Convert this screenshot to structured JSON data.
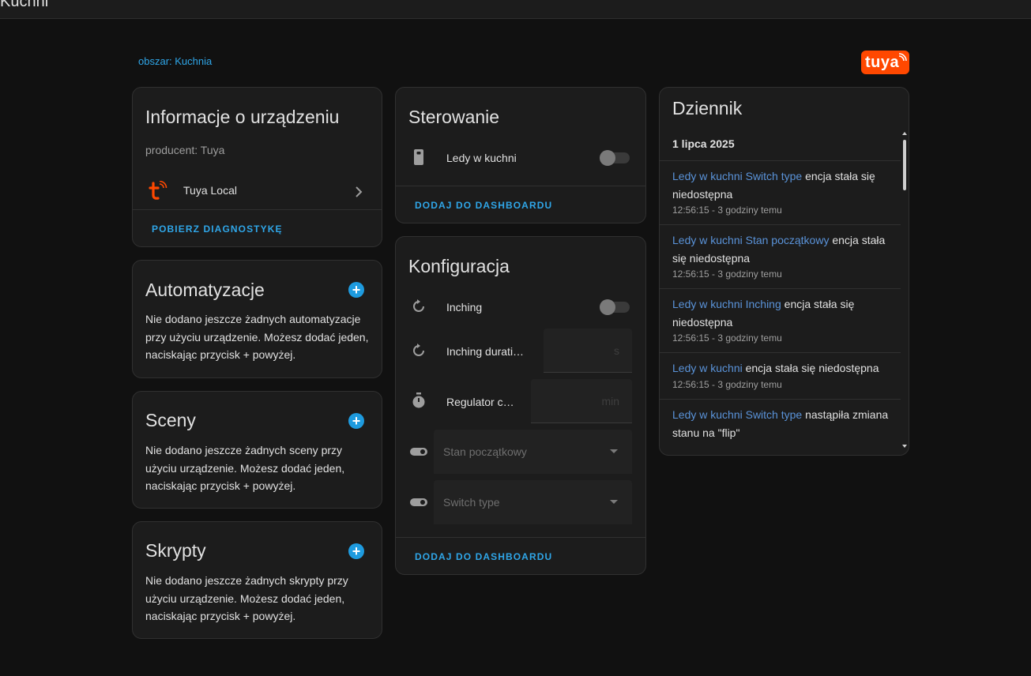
{
  "header": {
    "title": "Kuchni"
  },
  "area_link": "obszar: Kuchnia",
  "brand": {
    "logo_text": "tuya",
    "color": "#ff4800"
  },
  "device_info": {
    "title": "Informacje o urządzeniu",
    "manufacturer": "producent: Tuya",
    "integration": "Tuya Local",
    "action": "POBIERZ DIAGNOSTYKĘ"
  },
  "automations": {
    "title": "Automatyzacje",
    "text": "Nie dodano jeszcze żadnych automatyzacje przy użyciu urządzenie. Możesz dodać jeden, naciskając przycisk + powyżej."
  },
  "scenes": {
    "title": "Sceny",
    "text": "Nie dodano jeszcze żadnych sceny przy użyciu urządzenie. Możesz dodać jeden, naciskając przycisk + powyżej."
  },
  "scripts": {
    "title": "Skrypty",
    "text": "Nie dodano jeszcze żadnych skrypty przy użyciu urządzenie. Możesz dodać jeden, naciskając przycisk + powyżej."
  },
  "controls": {
    "title": "Sterowanie",
    "switch_label": "Ledy w kuchni",
    "switch_on": false,
    "action": "DODAJ DO DASHBOARDU"
  },
  "config": {
    "title": "Konfiguracja",
    "inching_label": "Inching",
    "inching_on": false,
    "inching_duration_label": "Inching durati…",
    "inching_duration_unit": "s",
    "timer_label": "Regulator cz…",
    "timer_unit": "min",
    "initial_state_label": "Stan początkowy",
    "switch_type_label": "Switch type",
    "action": "DODAJ DO DASHBOARDU"
  },
  "logbook": {
    "title": "Dziennik",
    "date": "1 lipca 2025",
    "entries": [
      {
        "entity": "Ledy w kuchni Switch type",
        "message": " encja stała się niedostępna",
        "time": "12:56:15 - 3 godziny temu"
      },
      {
        "entity": "Ledy w kuchni Stan początkowy",
        "message": " encja stała się niedostępna",
        "time": "12:56:15 - 3 godziny temu"
      },
      {
        "entity": "Ledy w kuchni Inching",
        "message": " encja stała się niedostępna",
        "time": "12:56:15 - 3 godziny temu"
      },
      {
        "entity": "Ledy w kuchni",
        "message": " encja stała się niedostępna",
        "time": "12:56:15 - 3 godziny temu"
      },
      {
        "entity": "Ledy w kuchni Switch type",
        "message": " nastąpiła zmiana stanu na \"flip\"",
        "time": ""
      }
    ]
  }
}
